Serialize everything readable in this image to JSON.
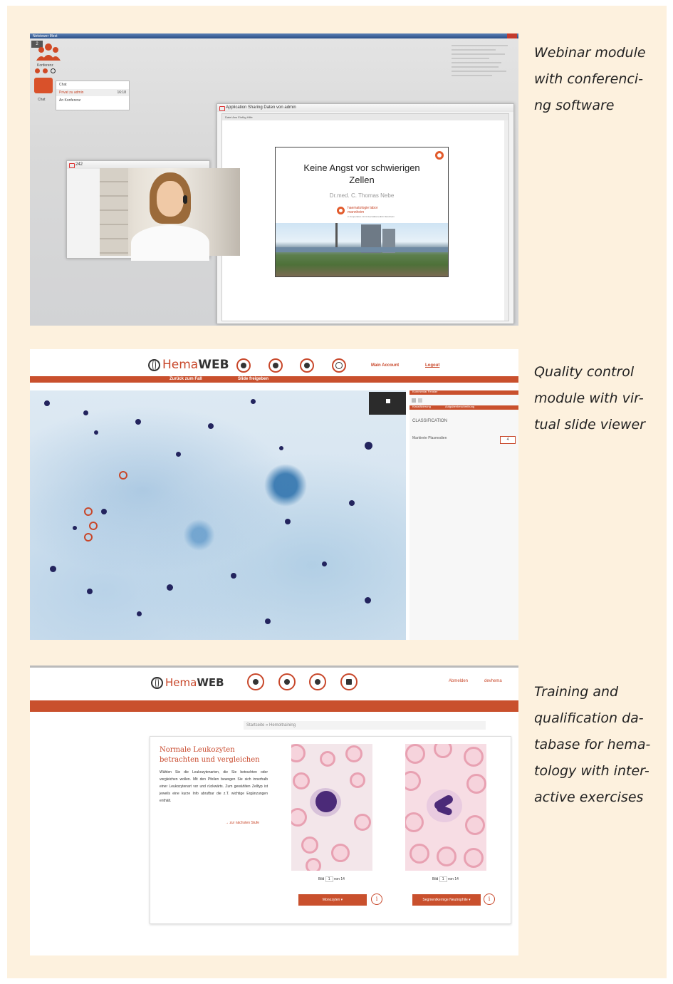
{
  "sections": [
    {
      "caption_lines": [
        "Webinar module",
        "with conferenci-",
        "ng software"
      ]
    },
    {
      "caption_lines": [
        "Quality control",
        "module with vir-",
        "tual slide viewer"
      ]
    },
    {
      "caption_lines": [
        "Training and",
        "qualification da-",
        "tabase for hema-",
        "tology with inter-",
        "active exercises"
      ]
    }
  ],
  "webinar": {
    "taskbar_label": "Netviewer Mest",
    "badge_count": "2",
    "conference_label": "Konferenz",
    "chat_label": "Chat",
    "chat_menu": {
      "header": "Chat",
      "item1": "Privat zu admin",
      "item1_time": "16:18",
      "item2": "An Konferenz"
    },
    "sharing_window_title": "Application Sharing Daten von admin",
    "sharing_menu": "Datei  Ans  Einfüg  Hilfe",
    "slide": {
      "title_line1": "Keine Angst vor schwierigen",
      "title_line2": "Zellen",
      "author": "Dr.med. C. Thomas Nebe",
      "logo_line1": "haematologie labor",
      "logo_line2": "mannheim",
      "logo_line3": "in Kooperation mit Universitätsmedizin Mannheim"
    },
    "video_window_title": "242"
  },
  "qc": {
    "logo_hema": "Hema",
    "logo_web": "WEB",
    "main_account": "Main Account",
    "logout": "Logout",
    "subnav_back": "Zurück zum Fall",
    "subnav_slide": "Slide freigeben",
    "panel_header": "Kommentar Fenster",
    "panel_tab1": "Klassifizierung",
    "panel_tab2": "Aufgabenbeschreibung",
    "classification_label": "CLASSIFICATION",
    "marked_label": "Markierte Plasmodien",
    "marked_value": "4"
  },
  "training": {
    "logo_hema": "Hema",
    "logo_web": "WEB",
    "link_logout": "Abmelden",
    "link_user": "devhema",
    "breadcrumb": "Startseite » Hemoltraining",
    "card_title_line1": "Normale Leukozyten",
    "card_title_line2": "betrachten und vergleichen",
    "card_body": "Wählen Sie die Leukozytenarten, die Sie betrachten oder vergleichen wollen. Mit den Pfeilen bewegen Sie sich innerhalb einer Leukozytenart vor und rückwärts. Zum gewählten Zelltyp ist jeweils eine kurze Info abrufbar die z.T. wichtige Ergänzungen enthält.",
    "card_link": "→ zur nächsten Stufe",
    "left_pager": {
      "prefix": "Bild",
      "value": "1",
      "suffix": "von 14"
    },
    "right_pager": {
      "prefix": "Bild",
      "value": "1",
      "suffix": "von 14"
    },
    "left_button": "Monozyten",
    "right_button": "Segmentkernige Neutrophile",
    "info_glyph": "i"
  },
  "colors": {
    "accent": "#c9502d",
    "background": "#fdf1de"
  }
}
